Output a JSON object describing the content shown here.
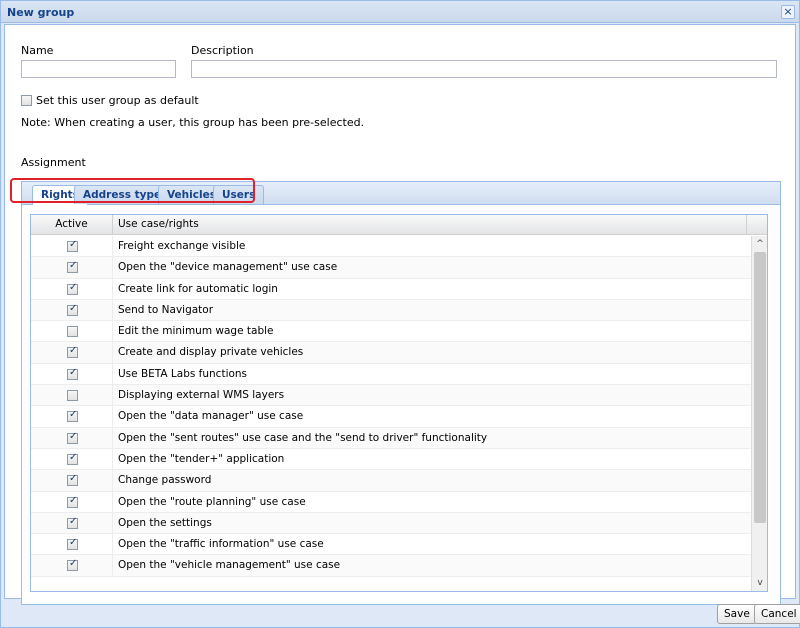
{
  "window": {
    "title": "New group",
    "close_glyph": "×"
  },
  "form": {
    "name_label": "Name",
    "name_value": "",
    "description_label": "Description",
    "description_value": "",
    "default_checkbox_label": "Set this user group as default",
    "default_checked": false,
    "note": "Note: When creating a user, this group has been pre-selected.",
    "assignment_label": "Assignment"
  },
  "tabs": [
    {
      "label": "Rights",
      "active": true
    },
    {
      "label": "Address types",
      "active": false
    },
    {
      "label": "Vehicles",
      "active": false
    },
    {
      "label": "Users",
      "active": false
    }
  ],
  "grid": {
    "col_active": "Active",
    "col_usecase": "Use case/rights",
    "rows": [
      {
        "active": true,
        "label": "Freight exchange visible"
      },
      {
        "active": true,
        "label": "Open the \"device management\" use case"
      },
      {
        "active": true,
        "label": "Create link for automatic login"
      },
      {
        "active": true,
        "label": "Send to Navigator"
      },
      {
        "active": false,
        "label": "Edit the minimum wage table"
      },
      {
        "active": true,
        "label": "Create and display private vehicles"
      },
      {
        "active": true,
        "label": "Use BETA Labs functions"
      },
      {
        "active": false,
        "label": "Displaying external WMS layers"
      },
      {
        "active": true,
        "label": "Open the \"data manager\" use case"
      },
      {
        "active": true,
        "label": "Open the \"sent routes\" use case and the \"send to driver\" functionality"
      },
      {
        "active": true,
        "label": "Open the \"tender+\" application"
      },
      {
        "active": true,
        "label": "Change password"
      },
      {
        "active": true,
        "label": "Open the \"route planning\" use case"
      },
      {
        "active": true,
        "label": "Open the settings"
      },
      {
        "active": true,
        "label": "Open the \"traffic information\" use case"
      },
      {
        "active": true,
        "label": "Open the \"vehicle management\" use case"
      }
    ]
  },
  "scrollbar": {
    "up_icon": "chevron-up-icon",
    "down_icon": "chevron-down-icon",
    "up_glyph": "^",
    "down_glyph": "v"
  },
  "buttons": {
    "save": "Save",
    "cancel": "Cancel"
  },
  "colors": {
    "accent": "#15428b",
    "border": "#99bbe8",
    "highlight": "#e0202b"
  }
}
